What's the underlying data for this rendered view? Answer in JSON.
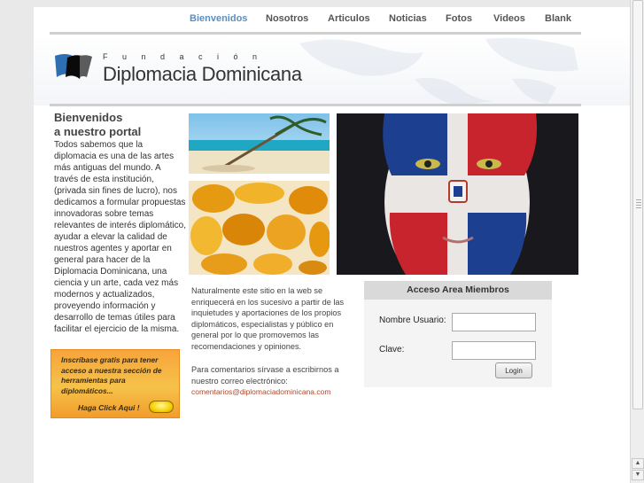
{
  "nav": {
    "items": [
      {
        "label": "Bienvenidos",
        "active": true
      },
      {
        "label": "Nosotros",
        "active": false
      },
      {
        "label": "Articulos",
        "active": false
      },
      {
        "label": "Noticias",
        "active": false
      },
      {
        "label": "Fotos",
        "active": false
      },
      {
        "label": "Videos",
        "active": false
      },
      {
        "label": "Blank",
        "active": false
      }
    ]
  },
  "header": {
    "foundation_label": "Fundación",
    "site_title": "Diplomacia Dominicana"
  },
  "welcome": {
    "title_line1": "Bienvenidos",
    "title_line2": "a nuestro portal",
    "body": "Todos sabemos que la diplomacia es una de las artes más antiguas del mundo. A través de esta institución, (privada sin fines de lucro), nos dedicamos a formular propuestas innovadoras sobre temas relevantes de interés diplomático, ayudar a elevar la calidad de nuestros agentes y aportar en general para hacer de la Diplomacia Dominicana, una ciencia y un arte, cada vez más modernos y actualizados, proveyendo información y desarrollo de temas útiles para facilitar el ejercicio de la misma."
  },
  "promo": {
    "text": "Inscríbase gratis para tener acceso a nuestra sección de herramientas para diplomáticos...",
    "cta": "Haga Click Aqui !"
  },
  "main": {
    "paragraph1": "Naturalmente este sitio en la web se enriquecerá en los sucesivo a partir de las inquietudes y aportaciones de los propios diplomáticos, especialistas y público en general por lo que promovemos las recomendaciones y opiniones.",
    "paragraph2": "Para comentarios sírvase a escribirnos a nuestro correo electrónico:",
    "email": "comentarios@diplomaciadominicana.com"
  },
  "members": {
    "title": "Acceso Area Miembros",
    "username_label": "Nombre Usuario:",
    "password_label": "Clave:",
    "username_value": "",
    "password_value": "",
    "login_label": "Login"
  },
  "colors": {
    "accent": "#5b8ec0",
    "promo": "#f6b73c",
    "link": "#b5482a"
  }
}
